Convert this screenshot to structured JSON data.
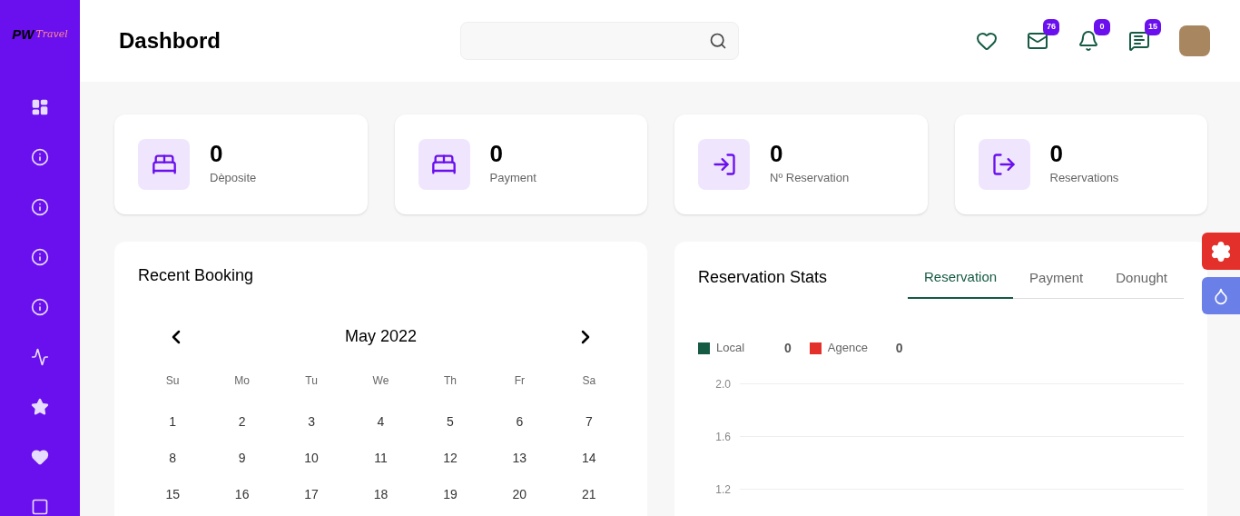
{
  "logo": {
    "mark": "PW",
    "script": "Travel"
  },
  "sidebar": {
    "items": [
      {
        "kind": "dashboard"
      },
      {
        "kind": "info"
      },
      {
        "kind": "info"
      },
      {
        "kind": "info"
      },
      {
        "kind": "info"
      },
      {
        "kind": "activity"
      },
      {
        "kind": "star"
      },
      {
        "kind": "heart"
      },
      {
        "kind": "box"
      }
    ]
  },
  "header": {
    "title": "Dashbord",
    "actions": [
      {
        "kind": "heart"
      },
      {
        "kind": "mail",
        "badge": "76"
      },
      {
        "kind": "bell",
        "badge": "0"
      },
      {
        "kind": "chat",
        "badge": "15"
      }
    ]
  },
  "stats": [
    {
      "kind": "bed",
      "value": "0",
      "label": "Dèposite"
    },
    {
      "kind": "bed",
      "value": "0",
      "label": "Payment"
    },
    {
      "kind": "login",
      "value": "0",
      "label": "Nº Reservation"
    },
    {
      "kind": "logout",
      "value": "0",
      "label": "Reservations"
    }
  ],
  "recent_booking": {
    "title": "Recent Booking",
    "calendar": {
      "month": "May 2022",
      "weekdays": [
        "Su",
        "Mo",
        "Tu",
        "We",
        "Th",
        "Fr",
        "Sa"
      ],
      "weeks": [
        [
          "1",
          "2",
          "3",
          "4",
          "5",
          "6",
          "7"
        ],
        [
          "8",
          "9",
          "10",
          "11",
          "12",
          "13",
          "14"
        ],
        [
          "15",
          "16",
          "17",
          "18",
          "19",
          "20",
          "21"
        ]
      ]
    }
  },
  "reservation_stats": {
    "title": "Reservation Stats",
    "tabs": [
      {
        "label": "Reservation",
        "selected": true
      },
      {
        "label": "Payment",
        "selected": false
      },
      {
        "label": "Donught",
        "selected": false
      }
    ],
    "legend": [
      {
        "label": "Local",
        "value": "0",
        "color": "#155a43"
      },
      {
        "label": "Agence",
        "value": "0",
        "color": "#e3302a"
      }
    ],
    "axis_labels": [
      "2.0",
      "1.6",
      "1.2"
    ]
  },
  "floating_buttons": [
    {
      "kind": "settings"
    },
    {
      "kind": "theme"
    }
  ]
}
